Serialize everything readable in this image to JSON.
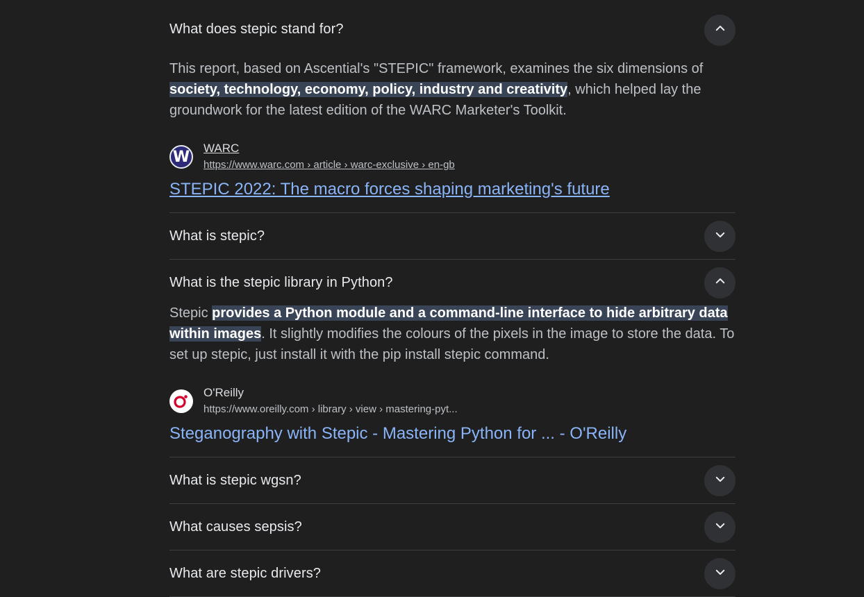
{
  "questions": [
    {
      "text": "What does stepic stand for?",
      "expanded": true,
      "answer": {
        "before": "This report, based on Ascential's \"STEPIC\" framework, examines the six dimensions of ",
        "highlight": "society, technology, economy, policy, industry and creativity",
        "after": ", which helped lay the groundwork for the latest edition of the WARC Marketer's Toolkit."
      },
      "source": {
        "name": "WARC",
        "favicon_letter": "W",
        "url": "https://www.warc.com › article › warc-exclusive › en-gb",
        "title": "STEPIC 2022: The macro forces shaping marketing's future"
      }
    },
    {
      "text": "What is stepic?",
      "expanded": false
    },
    {
      "text": "What is the stepic library in Python?",
      "expanded": true,
      "answer": {
        "before": "Stepic ",
        "highlight": "provides a Python module and a command-line interface to hide arbitrary data within images",
        "after": ". It slightly modifies the colours of the pixels in the image to store the data. To set up stepic, just install it with the pip install stepic command."
      },
      "source": {
        "name": "O'Reilly",
        "url": "https://www.oreilly.com › library › view › mastering-pyt...",
        "title": "Steganography with Stepic - Mastering Python for ... - O'Reilly"
      }
    },
    {
      "text": "What is stepic wgsn?",
      "expanded": false
    },
    {
      "text": "What causes sepsis?",
      "expanded": false
    },
    {
      "text": "What are stepic drivers?",
      "expanded": false
    }
  ],
  "colors": {
    "background": "#1f1f1f",
    "link": "#8ab4f8",
    "highlight_bg": "#394457",
    "divider": "#3c4043",
    "button_bg": "#303134",
    "oreilly_red": "#d3002d",
    "warc_navy": "#2e2a7a"
  },
  "icons": {
    "expanded": "chevron-up-icon",
    "collapsed": "chevron-down-icon"
  }
}
